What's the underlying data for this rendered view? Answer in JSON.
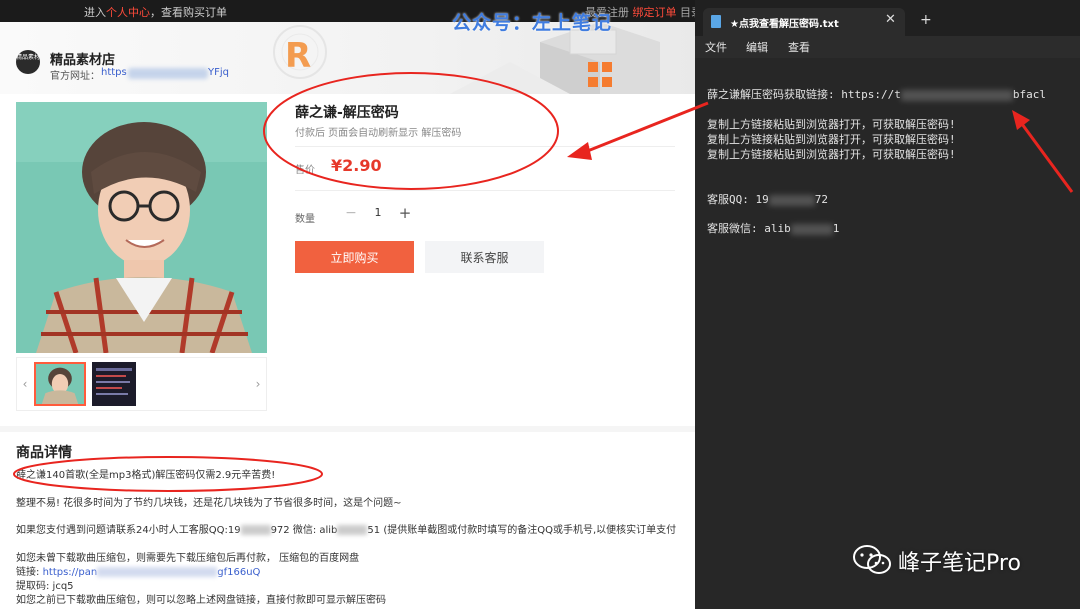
{
  "topbar": {
    "prefix": "进入",
    "link": "个人中心",
    "suffix": "，查看购买订单",
    "right_prefix": "最爱注册",
    "right_link": "绑定订单",
    "right_suffix": "目录"
  },
  "watermark": "公众号：左上笔记",
  "shop": {
    "logo_text": "精品素材",
    "name": "精品素材店",
    "url_label": "官方网址：",
    "url_start": "https",
    "url_end": "YFjq"
  },
  "product": {
    "title": "薛之谦-解压密码",
    "subtitle": "付款后 页面会自动刷新显示 解压密码",
    "price_label": "售价",
    "price": "¥2.90",
    "qty_label": "数量",
    "qty_minus": "−",
    "qty_value": "1",
    "qty_plus": "+",
    "buy_label": "立即购买",
    "service_label": "联系客服",
    "thumb_prev": "‹",
    "thumb_next": "›"
  },
  "details": {
    "heading": "商品详情",
    "line1": "薛之谦140首歌(全是mp3格式)解压密码仅需2.9元辛苦费!",
    "line2": "整理不易! 花很多时间为了节约几块钱，还是花几块钱为了节省很多时间，这是个问题~",
    "line3a": "如果您支付遇到问题请联系24小时人工客服QQ:19",
    "line3b": "972 微信: alib",
    "line3c": "51 (提供账单截图或付款时填写的备注QQ或手机号,以便核实订单支付",
    "line4": "如您未曾下载歌曲压缩包，则需要先下载压缩包后再付款， 压缩包的百度网盘",
    "line5a": "链接:",
    "line5b": "https://pan",
    "line5c": "gf166uQ",
    "line6": "提取码: jcq5",
    "line7": "如您之前已下载歌曲压缩包，则可以忽略上述网盘链接，直接付款即可显示解压密码"
  },
  "notepad": {
    "tab_title": "★点我查看解压密码.txt",
    "tab_close": "✕",
    "new_tab": "+",
    "menu": [
      "文件",
      "编辑",
      "查看"
    ],
    "line1a": "薛之谦解压密码获取链接: https://t",
    "line1b": "bfacl",
    "line2": "复制上方链接粘贴到浏览器打开，可获取解压密码!",
    "line3": "复制上方链接粘贴到浏览器打开，可获取解压密码!",
    "line4": "复制上方链接粘贴到浏览器打开，可获取解压密码!",
    "line5a": "客服QQ: 19",
    "line5b": "72",
    "line6a": "客服微信: alib",
    "line6b": "1"
  },
  "brand": "峰子笔记Pro",
  "colors": {
    "accent": "#f1613f",
    "price": "#e6382a",
    "annotation": "#e8251f",
    "notepad_bg": "#272727"
  }
}
